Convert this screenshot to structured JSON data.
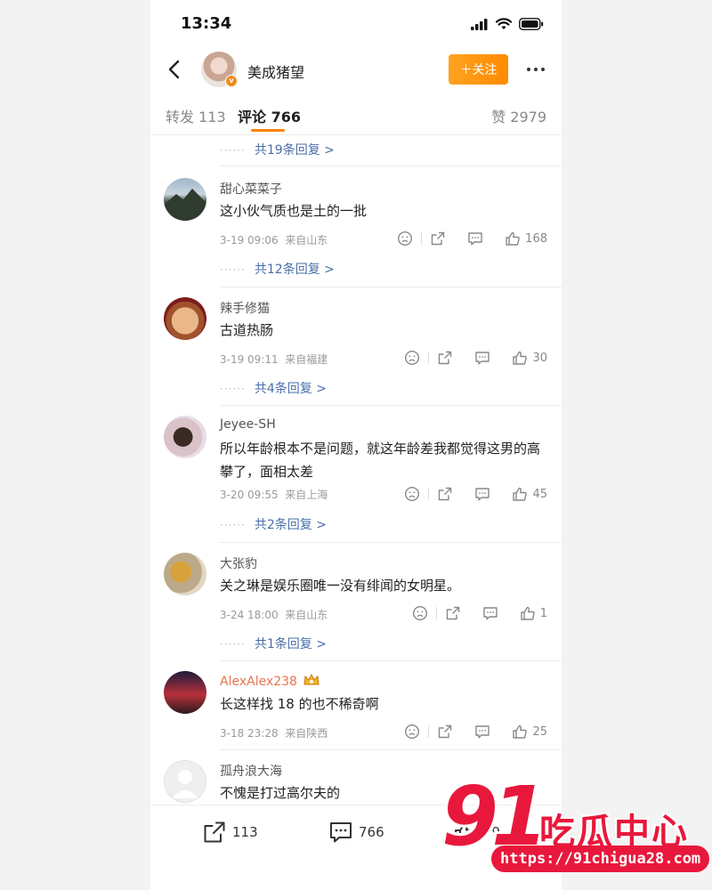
{
  "status_bar": {
    "time": "13:34"
  },
  "header": {
    "name": "美成猪望",
    "follow_label": "＋关注",
    "verified_mark": "v"
  },
  "tabs": {
    "repost": "转发 113",
    "comments": "评论 766",
    "likes": "赞 2979"
  },
  "top_reply_link": "共19条回复 >",
  "reply_dots": "······",
  "comments": [
    {
      "user": "甜心菜菜子",
      "text": "这小伙气质也是土的一批",
      "time": "3-19 09:06",
      "location": "来自山东",
      "likes": "168",
      "replies": "共12条回复 >"
    },
    {
      "user": "辣手修猫",
      "text": "古道热肠",
      "time": "3-19 09:11",
      "location": "来自福建",
      "likes": "30",
      "replies": "共4条回复 >"
    },
    {
      "user": "Jeyee-SH",
      "text": "所以年龄根本不是问题，就这年龄差我都觉得这男的高攀了，面相太差",
      "time": "3-20 09:55",
      "location": "来自上海",
      "likes": "45",
      "replies": "共2条回复 >"
    },
    {
      "user": "大张豹",
      "text": "关之琳是娱乐圈唯一没有绯闻的女明星。",
      "time": "3-24 18:00",
      "location": "来自山东",
      "likes": "1",
      "replies": "共1条回复 >"
    },
    {
      "user": "AlexAlex238",
      "text": "长这样找 18 的也不稀奇啊",
      "time": "3-18 23:28",
      "location": "来自陕西",
      "likes": "25",
      "replies": ""
    },
    {
      "user": "孤舟浪大海",
      "text": "不愧是打过高尔夫的",
      "time": "",
      "location": "",
      "likes": "",
      "replies": ""
    }
  ],
  "bottom_bar": {
    "repost_count": "113",
    "comment_count": "766",
    "like_count": "79"
  },
  "watermark": {
    "number": "91",
    "brand": "吃瓜中心",
    "url": "https://91chigua28.com"
  },
  "colors": {
    "accent_orange": "#ff8200",
    "link_blue": "#4a6ea9",
    "watermark_red": "#e8183c",
    "vip_name": "#eb7350"
  },
  "icons": [
    "back-arrow-icon",
    "more-dots-icon",
    "signal-icon",
    "wifi-icon",
    "battery-icon",
    "dislike-face-icon",
    "share-icon",
    "comment-icon",
    "thumbs-up-icon",
    "crown-badge-icon"
  ]
}
